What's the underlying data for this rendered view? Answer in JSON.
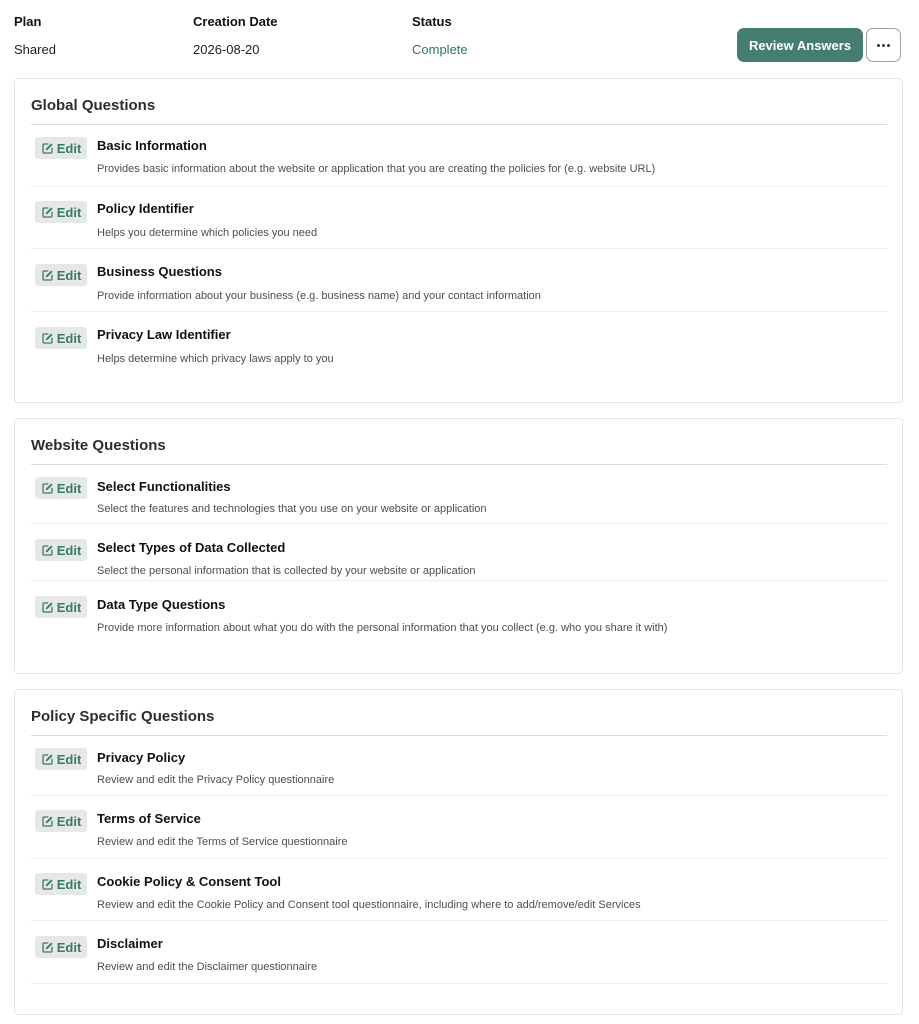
{
  "summary": {
    "plan_label": "Plan",
    "plan_value": "Shared",
    "date_label": "Creation Date",
    "date_value": "2026-08-20",
    "status_label": "Status",
    "status_value": "Complete"
  },
  "actions": {
    "review_label": "Review Answers",
    "more_icon": "ellipsis-icon"
  },
  "edit_label": "Edit",
  "colors": {
    "accent": "#457d70",
    "status": "#2f7a5c",
    "edit_text": "#3c7a66",
    "edit_bg": "#e6e8e7"
  },
  "sections": [
    {
      "title": "Global Questions",
      "items": [
        {
          "title": "Basic Information",
          "desc": "Provides basic information about the website or application that you are creating the policies for (e.g. website URL)"
        },
        {
          "title": "Policy Identifier",
          "desc": "Helps you determine which policies you need"
        },
        {
          "title": "Business Questions",
          "desc": "Provide information about your business (e.g. business name) and your contact information"
        },
        {
          "title": "Privacy Law Identifier",
          "desc": "Helps determine which privacy laws apply to you"
        }
      ]
    },
    {
      "title": "Website Questions",
      "items": [
        {
          "title": "Select Functionalities",
          "desc": "Select the features and technologies that you use on your website or application"
        },
        {
          "title": "Select Types of Data Collected",
          "desc": "Select the personal information that is collected by your website or application"
        },
        {
          "title": "Data Type Questions",
          "desc": "Provide more information about what you do with the personal information that you collect (e.g. who you share it with)"
        }
      ]
    },
    {
      "title": "Policy Specific Questions",
      "items": [
        {
          "title": "Privacy Policy",
          "desc": "Review and edit the Privacy Policy questionnaire"
        },
        {
          "title": "Terms of Service",
          "desc": "Review and edit the Terms of Service questionnaire"
        },
        {
          "title": "Cookie Policy & Consent Tool",
          "desc": "Review and edit the Cookie Policy and Consent tool questionnaire, including where to add/remove/edit Services"
        },
        {
          "title": "Disclaimer",
          "desc": "Review and edit the Disclaimer questionnaire"
        }
      ]
    }
  ]
}
